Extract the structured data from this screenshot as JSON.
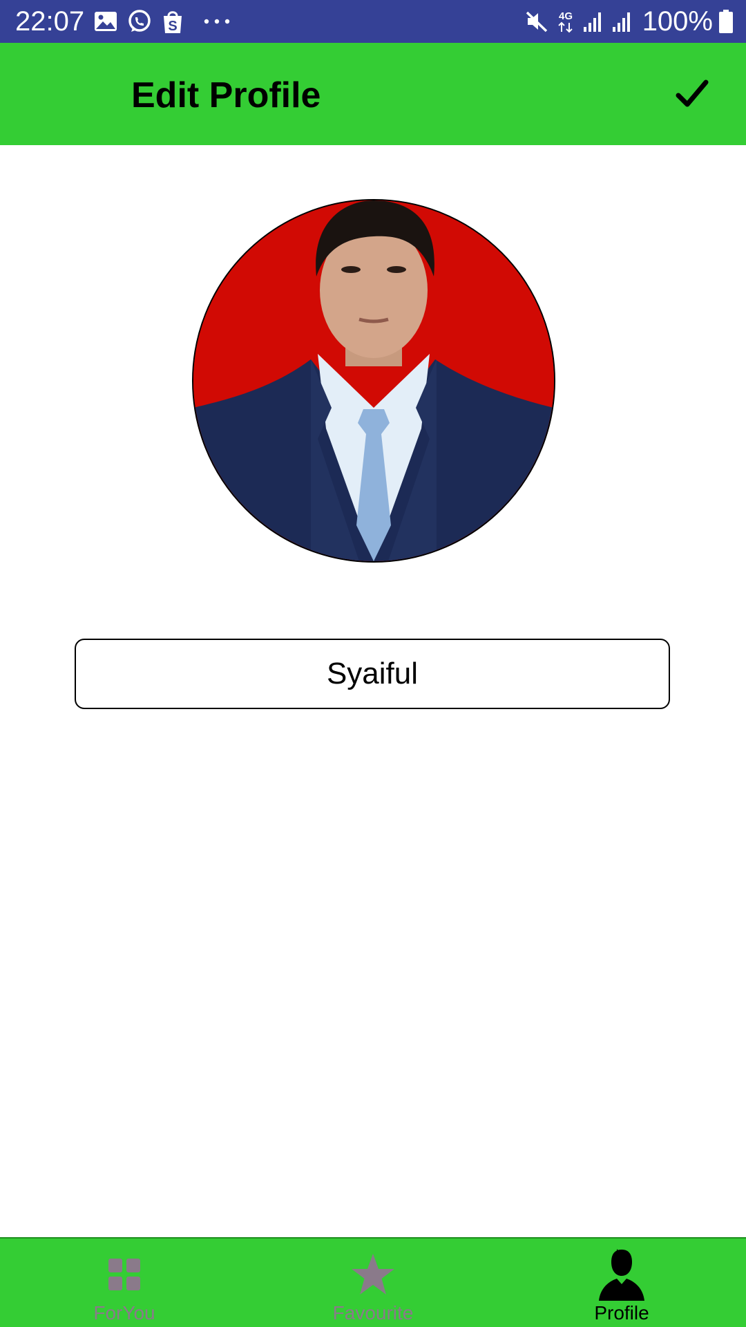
{
  "status_bar": {
    "time": "22:07",
    "battery_text": "100%",
    "left_icons": [
      "gallery-icon",
      "whatsapp-icon",
      "shopping-bag-icon",
      "more-dots-icon"
    ],
    "right_icons": [
      "mute-icon",
      "4g-data-icon",
      "signal-icon",
      "signal-icon",
      "battery-icon"
    ],
    "background_color": "#354196"
  },
  "app_bar": {
    "title": "Edit Profile",
    "confirm_icon": "check-icon",
    "background_color": "#34cd34"
  },
  "profile": {
    "avatar_icon": "profile-photo",
    "name_value": "Syaiful",
    "photo_background_color": "#d10a04"
  },
  "bottom_nav": {
    "background_color": "#34cd34",
    "items": [
      {
        "label": "ForYou",
        "icon": "grid-icon",
        "active": false
      },
      {
        "label": "Favourite",
        "icon": "star-icon",
        "active": false
      },
      {
        "label": "Profile",
        "icon": "person-icon",
        "active": true
      }
    ]
  }
}
